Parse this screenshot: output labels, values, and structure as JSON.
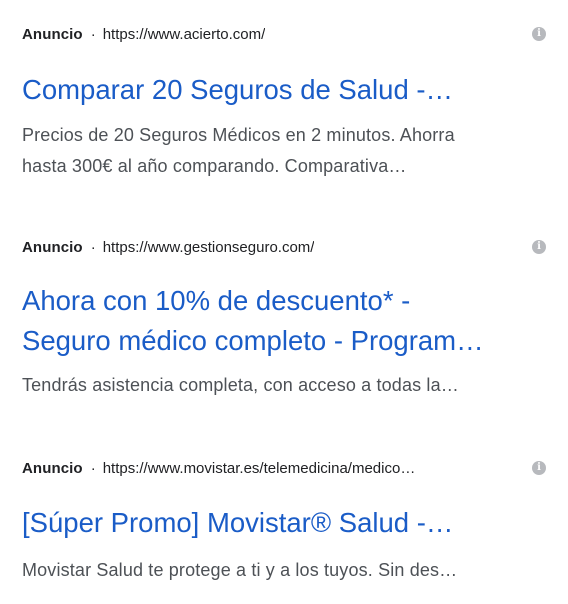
{
  "ads": [
    {
      "label": "Anuncio",
      "separator": "·",
      "url": "https://www.acierto.com/",
      "info_icon": "info-icon",
      "title_lines": [
        "Comparar 20 Seguros de Salud -…"
      ],
      "desc_lines": [
        "Precios de 20 Seguros Médicos en 2 minutos. Ahorra",
        "hasta 300€ al año comparando. Comparativa…"
      ]
    },
    {
      "label": "Anuncio",
      "separator": "·",
      "url": "https://www.gestionseguro.com/",
      "info_icon": "info-icon",
      "title_lines": [
        "Ahora con 10% de descuento* -",
        "Seguro médico completo - Program…"
      ],
      "desc_lines": [
        "Tendrás asistencia completa, con acceso a todas la…"
      ]
    },
    {
      "label": "Anuncio",
      "separator": "·",
      "url": "https://www.movistar.es/telemedicina/medico…",
      "info_icon": "info-icon",
      "title_lines": [
        "[Súper Promo] Movistar® Salud -…"
      ],
      "desc_lines": [
        "Movistar Salud te protege a ti y a los tuyos. Sin des…"
      ]
    }
  ],
  "colors": {
    "title": "#1a5cc7",
    "text": "#202124",
    "desc": "#4d5156",
    "icon": "#b7b9bd"
  }
}
